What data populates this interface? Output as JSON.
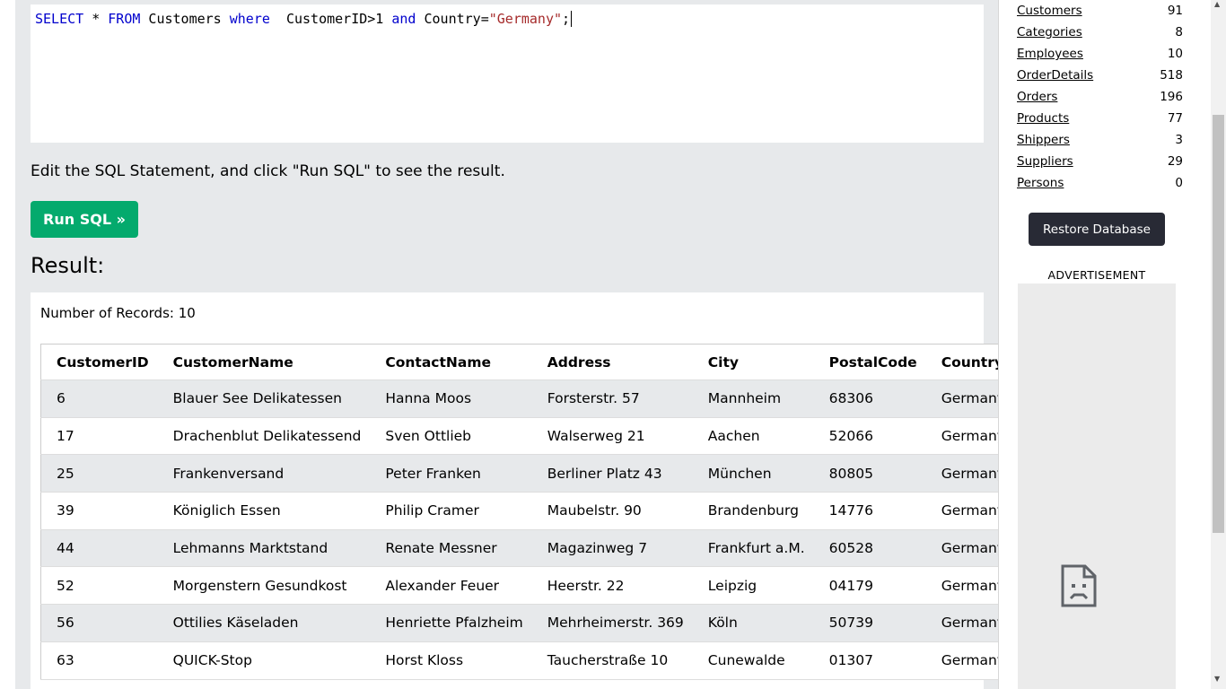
{
  "editor": {
    "kw_select": "SELECT",
    "plain_1": " * ",
    "kw_from": "FROM",
    "plain_2": " Customers ",
    "kw_where": "where",
    "plain_3": "  CustomerID>1 ",
    "kw_and": "and",
    "plain_4": " Country=",
    "string_lit": "\"Germany\"",
    "plain_5": ";"
  },
  "instructions": "Edit the SQL Statement, and click \"Run SQL\" to see the result.",
  "run_button": "Run SQL »",
  "result_heading": "Result:",
  "records_text": "Number of Records: 10",
  "table": {
    "headers": [
      "CustomerID",
      "CustomerName",
      "ContactName",
      "Address",
      "City",
      "PostalCode",
      "Country"
    ],
    "rows": [
      [
        "6",
        "Blauer See Delikatessen",
        "Hanna Moos",
        "Forsterstr. 57",
        "Mannheim",
        "68306",
        "Germany"
      ],
      [
        "17",
        "Drachenblut Delikatessend",
        "Sven Ottlieb",
        "Walserweg 21",
        "Aachen",
        "52066",
        "Germany"
      ],
      [
        "25",
        "Frankenversand",
        "Peter Franken",
        "Berliner Platz 43",
        "München",
        "80805",
        "Germany"
      ],
      [
        "39",
        "Königlich Essen",
        "Philip Cramer",
        "Maubelstr. 90",
        "Brandenburg",
        "14776",
        "Germany"
      ],
      [
        "44",
        "Lehmanns Marktstand",
        "Renate Messner",
        "Magazinweg 7",
        "Frankfurt a.M.",
        "60528",
        "Germany"
      ],
      [
        "52",
        "Morgenstern Gesundkost",
        "Alexander Feuer",
        "Heerstr. 22",
        "Leipzig",
        "04179",
        "Germany"
      ],
      [
        "56",
        "Ottilies Käseladen",
        "Henriette Pfalzheim",
        "Mehrheimerstr. 369",
        "Köln",
        "50739",
        "Germany"
      ],
      [
        "63",
        "QUICK-Stop",
        "Horst Kloss",
        "Taucherstraße 10",
        "Cunewalde",
        "01307",
        "Germany"
      ]
    ]
  },
  "sidebar": {
    "tables": [
      {
        "name": "Customers",
        "count": "91"
      },
      {
        "name": "Categories",
        "count": "8"
      },
      {
        "name": "Employees",
        "count": "10"
      },
      {
        "name": "OrderDetails",
        "count": "518"
      },
      {
        "name": "Orders",
        "count": "196"
      },
      {
        "name": "Products",
        "count": "77"
      },
      {
        "name": "Shippers",
        "count": "3"
      },
      {
        "name": "Suppliers",
        "count": "29"
      },
      {
        "name": "Persons",
        "count": "0"
      }
    ],
    "restore_button": "Restore Database",
    "ad_label": "ADVERTISEMENT",
    "ad_icon": "broken-page-icon"
  },
  "colors": {
    "run_button_bg": "#04aa6d",
    "restore_button_bg": "#282a35",
    "sql_keyword": "#0000cd",
    "sql_string": "#a52a2a",
    "panel_bg": "#e7e9eb"
  }
}
